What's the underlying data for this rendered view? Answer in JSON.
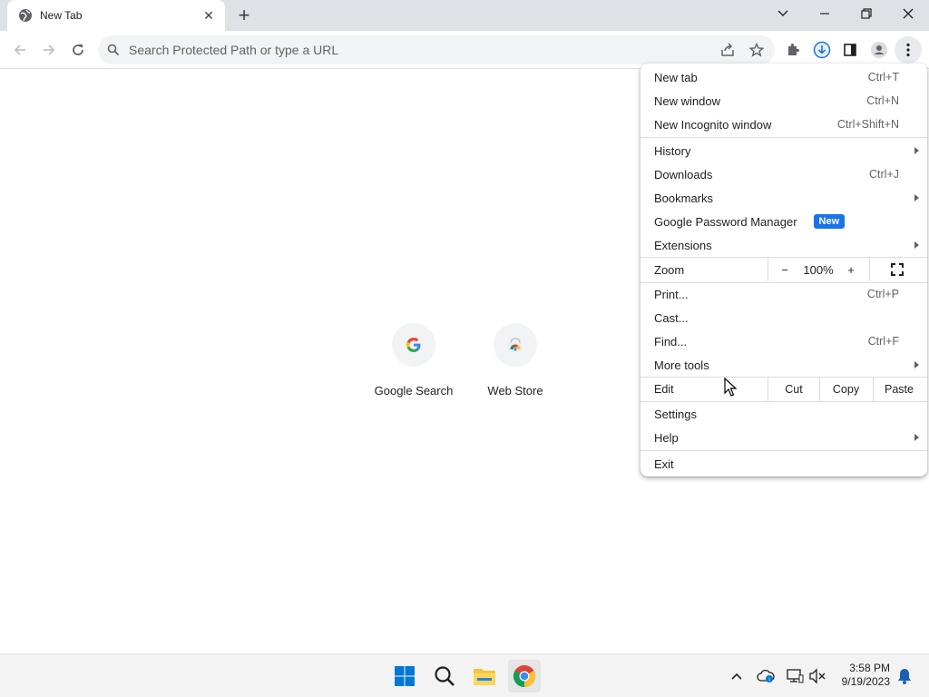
{
  "tab": {
    "title": "New Tab",
    "close_glyph": "✕",
    "new_tab_glyph": "+"
  },
  "omnibox": {
    "placeholder": "Search Protected Path or type a URL"
  },
  "shortcuts": [
    {
      "label": "Google Search",
      "icon": "google-g-icon"
    },
    {
      "label": "Web Store",
      "icon": "chrome-web-store-icon"
    }
  ],
  "menu": {
    "new_tab": {
      "label": "New tab",
      "shortcut": "Ctrl+T"
    },
    "new_window": {
      "label": "New window",
      "shortcut": "Ctrl+N"
    },
    "new_incognito": {
      "label": "New Incognito window",
      "shortcut": "Ctrl+Shift+N"
    },
    "history": {
      "label": "History"
    },
    "downloads": {
      "label": "Downloads",
      "shortcut": "Ctrl+J"
    },
    "bookmarks": {
      "label": "Bookmarks"
    },
    "password_manager": {
      "label": "Google Password Manager",
      "badge": "New"
    },
    "extensions": {
      "label": "Extensions"
    },
    "zoom": {
      "label": "Zoom",
      "minus": "−",
      "value": "100%",
      "plus": "+"
    },
    "print": {
      "label": "Print...",
      "shortcut": "Ctrl+P"
    },
    "cast": {
      "label": "Cast..."
    },
    "find": {
      "label": "Find...",
      "shortcut": "Ctrl+F"
    },
    "more_tools": {
      "label": "More tools"
    },
    "edit": {
      "label": "Edit",
      "cut": "Cut",
      "copy": "Copy",
      "paste": "Paste"
    },
    "settings": {
      "label": "Settings"
    },
    "help": {
      "label": "Help"
    },
    "exit": {
      "label": "Exit"
    }
  },
  "taskbar": {
    "time": "3:58 PM",
    "date": "9/19/2023"
  },
  "colors": {
    "accent": "#1a73e8",
    "tabstrip": "#dee1e6",
    "omnibox_bg": "#f1f3f4"
  }
}
